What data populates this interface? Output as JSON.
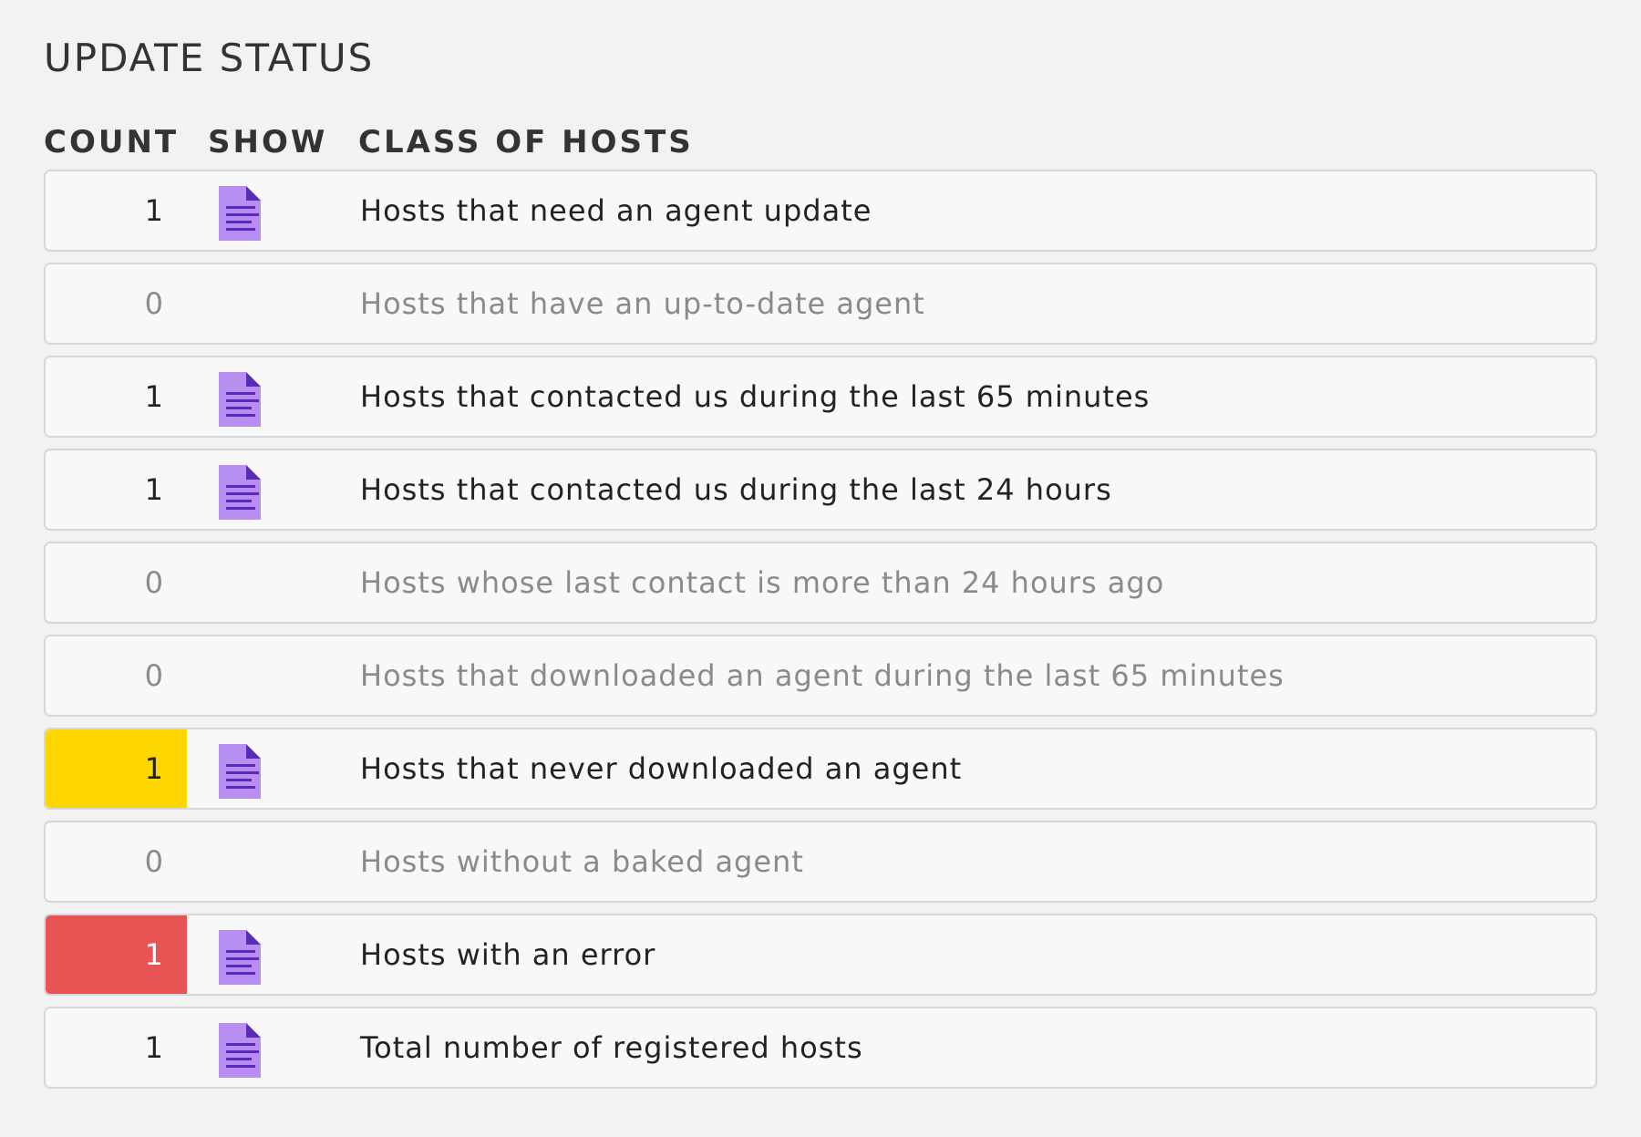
{
  "title": "UPDATE STATUS",
  "columns": {
    "count": "COUNT",
    "show": "SHOW",
    "class": "CLASS OF HOSTS"
  },
  "colors": {
    "warn": "#ffd700",
    "crit": "#e85454",
    "icon": "#b88ef0"
  },
  "rows": [
    {
      "count": "1",
      "class": "Hosts that need an agent update",
      "show_icon": "document-icon",
      "state": "normal"
    },
    {
      "count": "0",
      "class": "Hosts that have an up-to-date agent",
      "show_icon": "",
      "state": "zero"
    },
    {
      "count": "1",
      "class": "Hosts that contacted us during the last 65 minutes",
      "show_icon": "document-icon",
      "state": "normal"
    },
    {
      "count": "1",
      "class": "Hosts that contacted us during the last 24 hours",
      "show_icon": "document-icon",
      "state": "normal"
    },
    {
      "count": "0",
      "class": "Hosts whose last contact is more than 24 hours ago",
      "show_icon": "",
      "state": "zero"
    },
    {
      "count": "0",
      "class": "Hosts that downloaded an agent during the last 65 minutes",
      "show_icon": "",
      "state": "zero"
    },
    {
      "count": "1",
      "class": "Hosts that never downloaded an agent",
      "show_icon": "document-icon",
      "state": "warn"
    },
    {
      "count": "0",
      "class": "Hosts without a baked agent",
      "show_icon": "",
      "state": "zero"
    },
    {
      "count": "1",
      "class": "Hosts with an error",
      "show_icon": "document-icon",
      "state": "crit"
    },
    {
      "count": "1",
      "class": "Total number of registered hosts",
      "show_icon": "document-icon",
      "state": "normal"
    }
  ]
}
